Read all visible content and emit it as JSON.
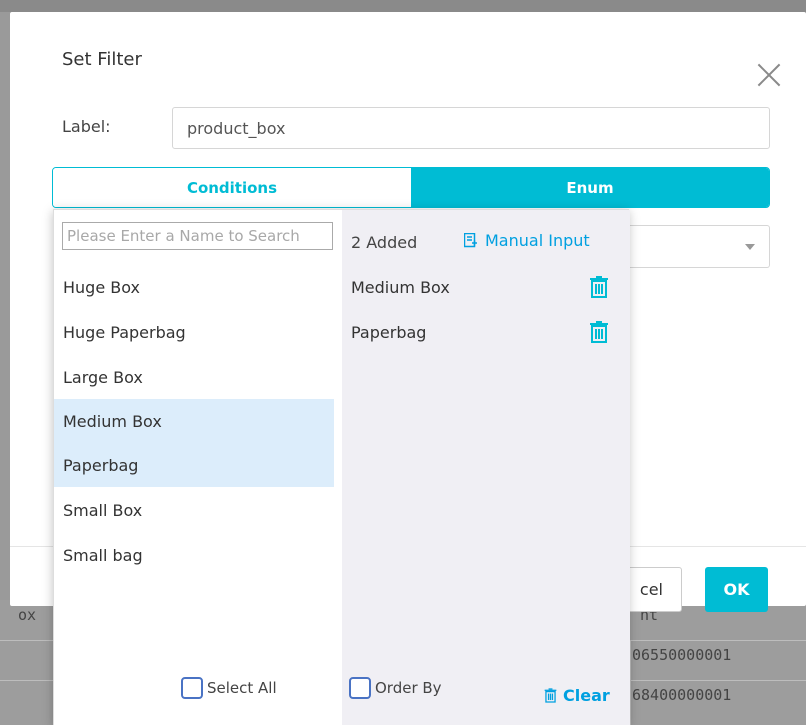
{
  "modal": {
    "title": "Set Filter",
    "label_text": "Label:",
    "label_value": "product_box",
    "tabs": [
      {
        "label": "Conditions",
        "active": false
      },
      {
        "label": "Enum",
        "active": true
      }
    ],
    "cancel_label": "cel",
    "ok_label": "OK"
  },
  "dropdown": {
    "search_placeholder": "Please Enter a Name to Search",
    "options": [
      {
        "label": "Huge Box",
        "selected": false
      },
      {
        "label": "Huge Paperbag",
        "selected": false
      },
      {
        "label": "Large Box",
        "selected": false
      },
      {
        "label": "Medium Box",
        "selected": true
      },
      {
        "label": "Paperbag",
        "selected": true
      },
      {
        "label": "Small Box",
        "selected": false
      },
      {
        "label": "Small bag",
        "selected": false
      }
    ],
    "select_all_label": "Select All",
    "added_count": "2 Added",
    "manual_input_label": "Manual Input",
    "added_items": [
      "Medium Box",
      "Paperbag"
    ],
    "order_by_label": "Order By",
    "clear_label": "Clear"
  },
  "background": {
    "cells": [
      "ox",
      "nt",
      "06550000001",
      "68400000001"
    ]
  },
  "colors": {
    "accent": "#00bcd4",
    "link": "#00a0e0",
    "selected_row": "#dcedfb",
    "right_pane": "#f0eff4"
  }
}
